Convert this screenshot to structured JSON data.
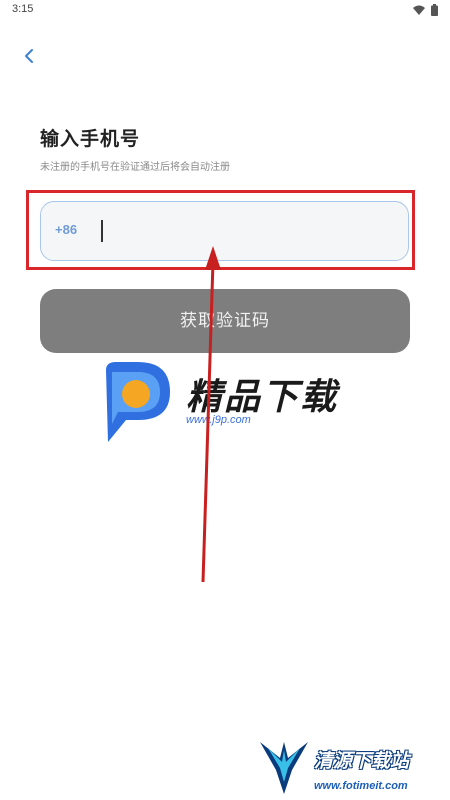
{
  "status_bar": {
    "time": "3:15",
    "icons": [
      "wifi-icon",
      "battery-icon"
    ]
  },
  "header": {
    "back_icon": "chevron-left-icon"
  },
  "login": {
    "title": "输入手机号",
    "subtitle": "未注册的手机号在验证通过后将会自动注册",
    "country_code": "+86",
    "phone_value": "",
    "get_code_label": "获取验证码"
  },
  "watermarks": {
    "top": {
      "logo_text": "精品下载",
      "url": "www.j9p.com"
    },
    "bottom": {
      "logo_text": "清源下载站",
      "url": "www.fotimeit.com"
    }
  },
  "colors": {
    "accent": "#6f9bd6",
    "button_disabled": "#7e7e7e",
    "annotation_red": "#d8262a"
  }
}
